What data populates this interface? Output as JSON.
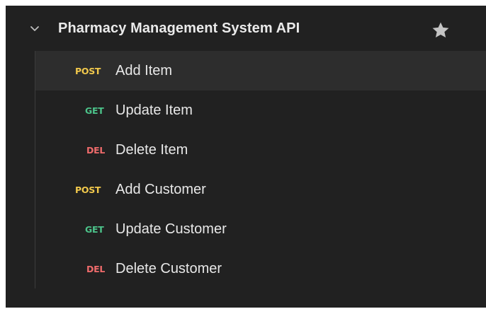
{
  "collection": {
    "title": "Pharmacy Management System API",
    "expanded": true,
    "starred": true
  },
  "requests": [
    {
      "method": "POST",
      "name": "Add Item",
      "active": true
    },
    {
      "method": "GET",
      "name": "Update Item",
      "active": false
    },
    {
      "method": "DEL",
      "name": "Delete Item",
      "active": false
    },
    {
      "method": "POST",
      "name": "Add Customer",
      "active": false
    },
    {
      "method": "GET",
      "name": "Update Customer",
      "active": false
    },
    {
      "method": "DEL",
      "name": "Delete Customer",
      "active": false
    }
  ],
  "icons": {
    "collapse": "chevron-down-icon",
    "favorite": "star-icon"
  },
  "colors": {
    "background": "#212121",
    "active_row": "#2d2d2d",
    "post": "#f2c94c",
    "get": "#4cc38a",
    "del": "#ef6b6b",
    "text": "#e8e8e8"
  }
}
